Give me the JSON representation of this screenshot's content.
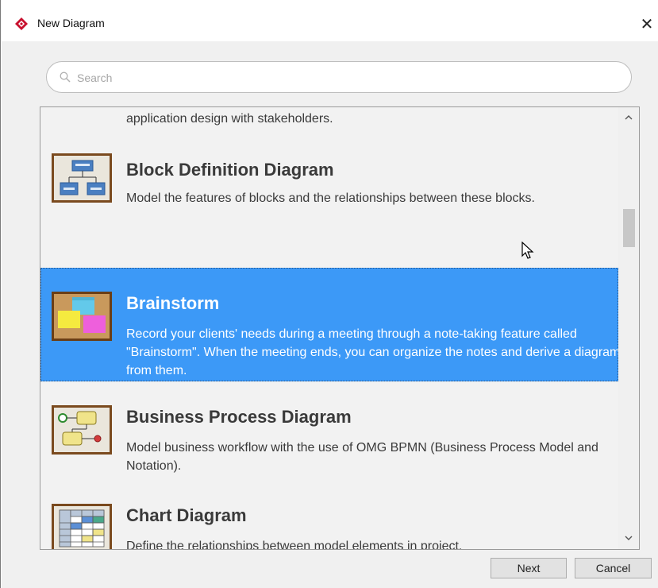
{
  "window": {
    "title": "New Diagram",
    "close_symbol": "✕",
    "app_icon": "visual-paradigm-logo-icon",
    "accent_color": "#3c99f7"
  },
  "search": {
    "placeholder": "Search",
    "value": ""
  },
  "list": {
    "partial_item": {
      "description": "application design with stakeholders."
    },
    "items": [
      {
        "title": "Block Definition Diagram",
        "description": "Model the features of blocks and the relationships between these blocks.",
        "icon": "block-definition-diagram-icon",
        "selected": false
      },
      {
        "title": "Brainstorm",
        "description": "Record your clients' needs during a meeting through a note-taking feature called \"Brainstorm\". When the meeting ends, you can organize the notes and derive a diagram from them.",
        "icon": "brainstorm-icon",
        "selected": true
      },
      {
        "title": "Business Process Diagram",
        "description": "Model business workflow with the use of OMG BPMN (Business Process Model and Notation).",
        "icon": "business-process-diagram-icon",
        "selected": false
      },
      {
        "title": "Chart Diagram",
        "description": "Define the relationships between model elements in project.",
        "icon": "chart-diagram-icon",
        "selected": false
      }
    ]
  },
  "scrollbar": {
    "up_symbol": "⌃",
    "down_symbol": "⌄"
  },
  "buttons": {
    "next": "Next",
    "cancel": "Cancel"
  }
}
